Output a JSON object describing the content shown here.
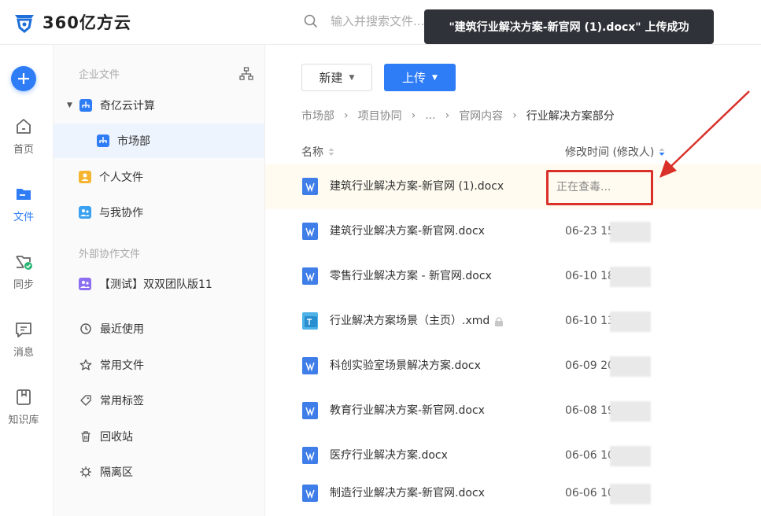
{
  "app": {
    "logo_text": "360亿方云"
  },
  "search": {
    "placeholder": "输入并搜索文件..."
  },
  "toast": {
    "message": "\"建筑行业解决方案-新官网 (1).docx\" 上传成功"
  },
  "rail": [
    {
      "label": "首页",
      "icon": "home-icon"
    },
    {
      "label": "文件",
      "icon": "folder-icon"
    },
    {
      "label": "同步",
      "icon": "sync-folder-icon"
    },
    {
      "label": "消息",
      "icon": "message-icon"
    },
    {
      "label": "知识库",
      "icon": "knowledge-icon"
    }
  ],
  "tree": {
    "enterprise_title": "企业文件",
    "org": "奇亿云计算",
    "dept": "市场部",
    "personal": "个人文件",
    "shared": "与我协作",
    "external_title": "外部协作文件",
    "team": "【测试】双双团队版11",
    "recent": "最近使用",
    "favorites": "常用文件",
    "tags": "常用标签",
    "trash": "回收站",
    "quarantine": "隔离区"
  },
  "toolbar": {
    "new_label": "新建",
    "upload_label": "上传"
  },
  "breadcrumb": [
    "市场部",
    "项目协同",
    "...",
    "官网内容",
    "行业解决方案部分"
  ],
  "columns": {
    "name": "名称",
    "modified": "修改时间 (修改人)"
  },
  "files": [
    {
      "name": "建筑行业解决方案-新官网 (1).docx",
      "date": "",
      "status": "正在查毒...",
      "type": "docx"
    },
    {
      "name": "建筑行业解决方案-新官网.docx",
      "date": "06-23 15:0",
      "type": "docx"
    },
    {
      "name": "零售行业解决方案 - 新官网.docx",
      "date": "06-10 18:",
      "type": "docx"
    },
    {
      "name": "行业解决方案场景（主页）.xmd",
      "date": "06-10 13:",
      "type": "xmd",
      "locked": true
    },
    {
      "name": "科创实验室场景解决方案.docx",
      "date": "06-09 20:",
      "type": "docx"
    },
    {
      "name": "教育行业解决方案-新官网.docx",
      "date": "06-08 19:1",
      "type": "docx"
    },
    {
      "name": "医疗行业解决方案.docx",
      "date": "06-06 10:",
      "type": "docx"
    },
    {
      "name": "制造行业解决方案-新官网.docx",
      "date": "06-06 10:",
      "type": "docx"
    }
  ],
  "colors": {
    "accent": "#2e7cf6",
    "annotation": "#d9312a",
    "toast_bg": "#2f3238"
  }
}
